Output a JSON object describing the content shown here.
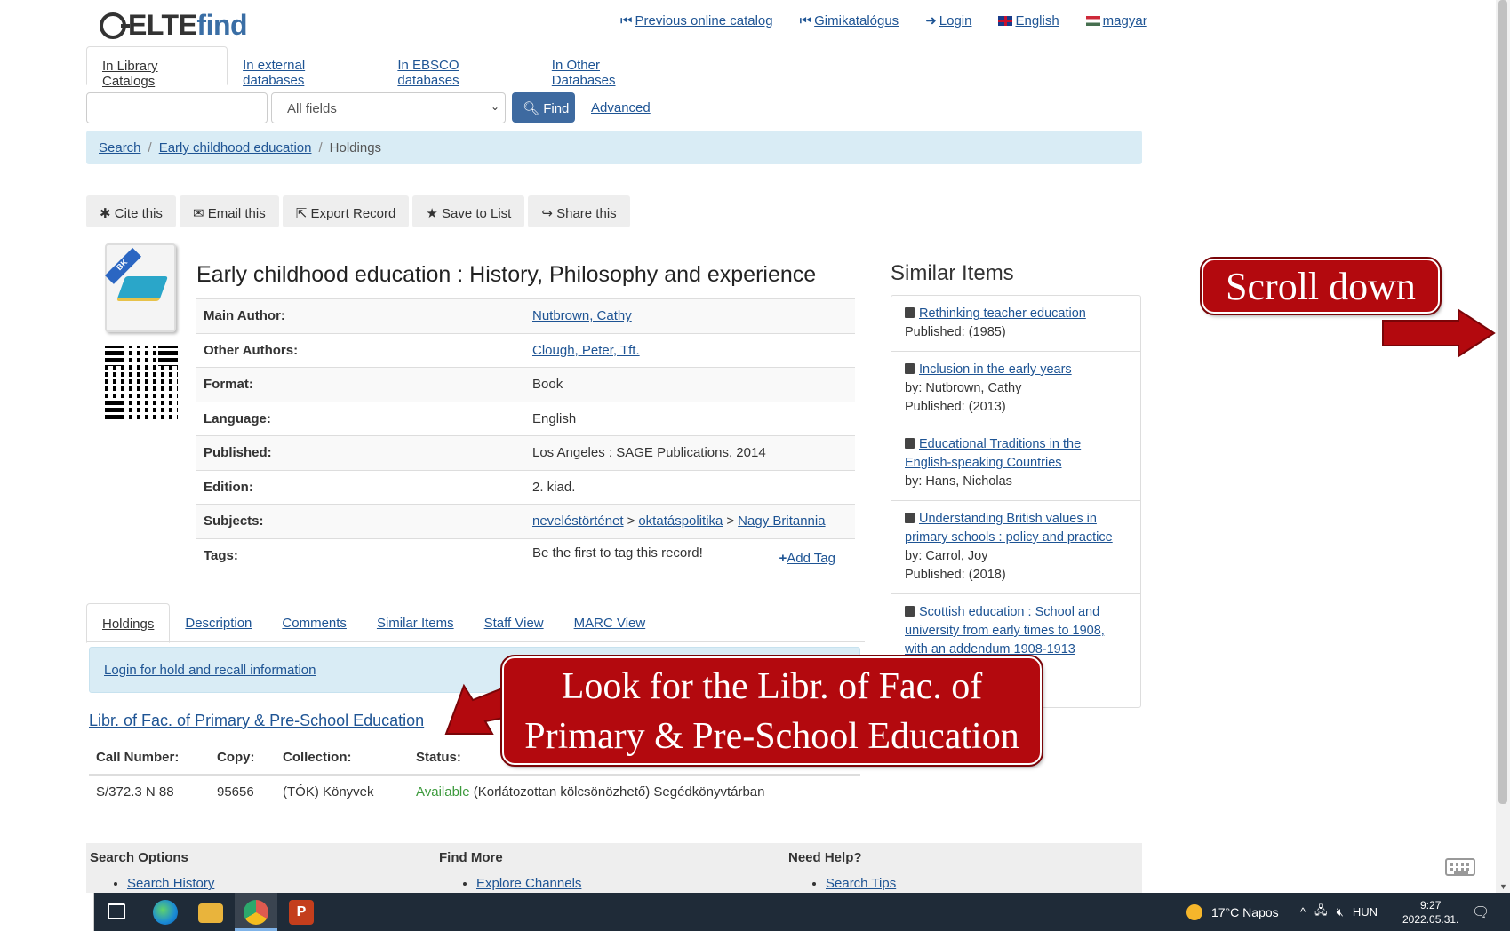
{
  "header": {
    "logo_main": "ELTE",
    "logo_find": "find",
    "nav": [
      "Previous online catalog",
      "Gimikatalógus",
      "Login",
      "English",
      "magyar"
    ]
  },
  "search": {
    "tabs": [
      "In Library Catalogs",
      "In external databases",
      "In EBSCO databases",
      "In Other Databases"
    ],
    "input_value": "",
    "type_selected": "All fields",
    "find_label": "Find",
    "advanced_label": "Advanced"
  },
  "breadcrumb": {
    "items": [
      "Search",
      "Early childhood education",
      "Holdings"
    ]
  },
  "toolbar": [
    "Cite this",
    "Email this",
    "Export Record",
    "Save to List",
    "Share this"
  ],
  "record": {
    "cover_badge": "BK",
    "title": "Early childhood education : History, Philosophy and experience",
    "fields": [
      {
        "label": "Main Author:",
        "value": "Nutbrown, Cathy"
      },
      {
        "label": "Other Authors:",
        "value": "Clough, Peter, Tft."
      },
      {
        "label": "Format:",
        "value": "Book"
      },
      {
        "label": "Language:",
        "value": "English"
      },
      {
        "label": "Published:",
        "value": "Los Angeles : SAGE Publications, 2014"
      },
      {
        "label": "Edition:",
        "value": "2. kiad."
      },
      {
        "label": "Subjects:",
        "value": ""
      },
      {
        "label": "Tags:",
        "value": "Be the first to tag this record!"
      }
    ],
    "subjects": [
      "neveléstörténet",
      "oktatáspolitika",
      "Nagy Britannia"
    ],
    "add_tag": "Add Tag"
  },
  "record_tabs": [
    "Holdings",
    "Description",
    "Comments",
    "Similar Items",
    "Staff View",
    "MARC View"
  ],
  "holdings": {
    "login_notice": "Login for hold and recall information",
    "library": "Libr. of Fac. of Primary & Pre-School Education",
    "headers": [
      "Call Number:",
      "Copy:",
      "Collection:",
      "Status:"
    ],
    "row": {
      "call_number": "S/372.3 N 88",
      "copy": "95656",
      "collection": "(TÓK) Könyvek",
      "status": "Available",
      "status_note": "(Korlátozottan kölcsönözhető) Segédkönyvtárban"
    }
  },
  "similar": {
    "heading": "Similar Items",
    "items": [
      {
        "title": "Rethinking teacher education",
        "line2": "Published: (1985)",
        "line3": ""
      },
      {
        "title": "Inclusion in the early years",
        "line2": "by: Nutbrown, Cathy",
        "line3": "Published: (2013)"
      },
      {
        "title": "Educational Traditions in the English-speaking Countries",
        "line2": "by: Hans, Nicholas",
        "line3": ""
      },
      {
        "title": "Understanding British values in primary schools : policy and practice",
        "line2": "by: Carrol, Joy",
        "line3": "Published: (2018)"
      },
      {
        "title": "Scottish education : School and university from early times to 1908, with an addendum 1908-1913",
        "line2": "",
        "line3": ""
      }
    ]
  },
  "footer": {
    "cols": [
      {
        "heading": "Search Options",
        "item": "Search History"
      },
      {
        "heading": "Find More",
        "item": "Explore Channels"
      },
      {
        "heading": "Need Help?",
        "item": "Search Tips"
      }
    ]
  },
  "annotations": {
    "scroll": "Scroll down",
    "look_line1": "Look for the Libr. of Fac. of",
    "look_line2": "Primary & Pre-School Education"
  },
  "taskbar": {
    "weather": "17°C  Napos",
    "lang": "HUN",
    "time": "9:27",
    "date": "2022.05.31."
  },
  "colors": {
    "link": "#1e5494",
    "accent": "#3e6aa0",
    "callout": "#b3090e",
    "available": "#3c9a3c"
  }
}
